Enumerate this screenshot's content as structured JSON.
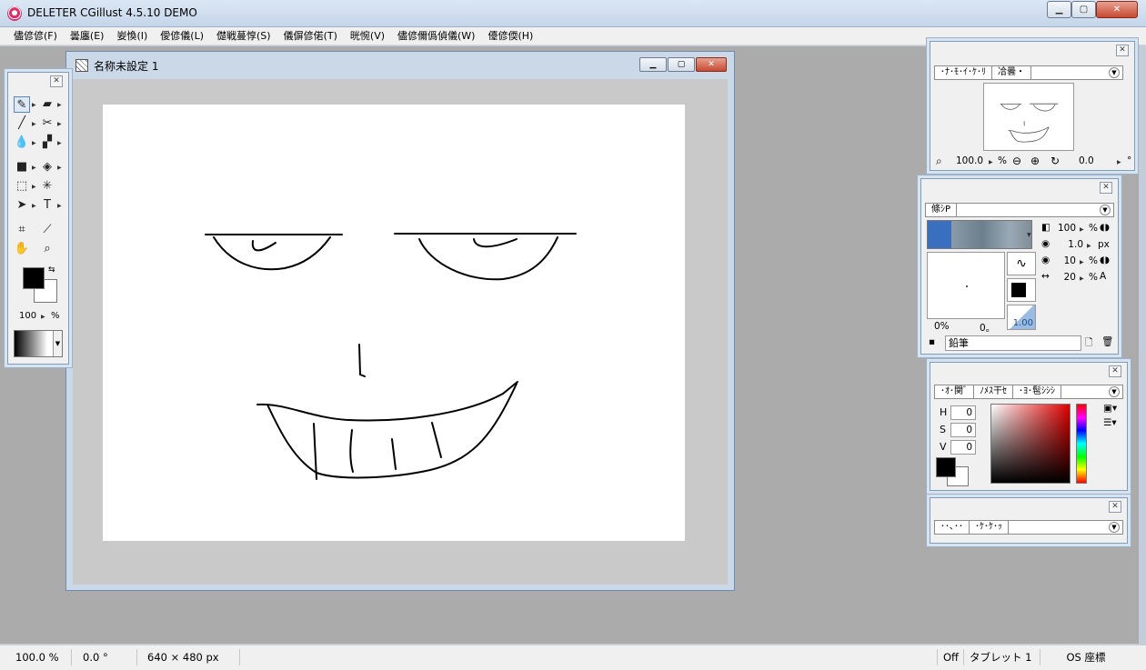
{
  "app": {
    "title": "DELETER CGillust 4.5.10 DEMO"
  },
  "menu": [
    "儘偐偐(F)",
    "曇廛(E)",
    "妛愌(I)",
    "僾偐儀(L)",
    "儊戦蔓惇(S)",
    "儀偋偐偌(T)",
    "晄惋(V)",
    "儘偐儞僞偵儀(W)",
    "儓偐偄(H)"
  ],
  "document": {
    "title": "名称未設定 1"
  },
  "toolbox": {
    "opacity": "100",
    "opacity_unit": "%"
  },
  "navigator": {
    "tabs": [
      "･ﾅ･ﾓ･ｲ･ｹ･ﾘ",
      "冾曇・"
    ],
    "zoom": "100.0",
    "zoom_unit": "%",
    "rotation": "0.0",
    "rotation_unit": "°"
  },
  "brush": {
    "tab": "條ｼP",
    "opacity": "100",
    "opacity_unit": "%",
    "size": "1.0",
    "size_unit": "px",
    "density": "10",
    "density_unit": "%",
    "spacing": "20",
    "spacing_unit": "%",
    "left_value": "0%",
    "right_value": "0。",
    "density_label": "1.00",
    "name": "鉛筆"
  },
  "color": {
    "tabs": [
      "･ｵ･関ﾞ",
      "ﾉﾒｽ干ｾ",
      "･ﾖ･髢ｼｼｼ"
    ],
    "h_label": "H",
    "s_label": "S",
    "v_label": "V",
    "h": "0",
    "s": "0",
    "v": "0"
  },
  "layer": {
    "tabs": [
      "･･､･･",
      "･ｹ･ｹ･ｯ"
    ]
  },
  "status": {
    "zoom": "100.0 %",
    "angle": "0.0 °",
    "size": "640 × 480 px",
    "off": "Off",
    "tablet": "タブレット 1",
    "os": "OS 座標"
  }
}
